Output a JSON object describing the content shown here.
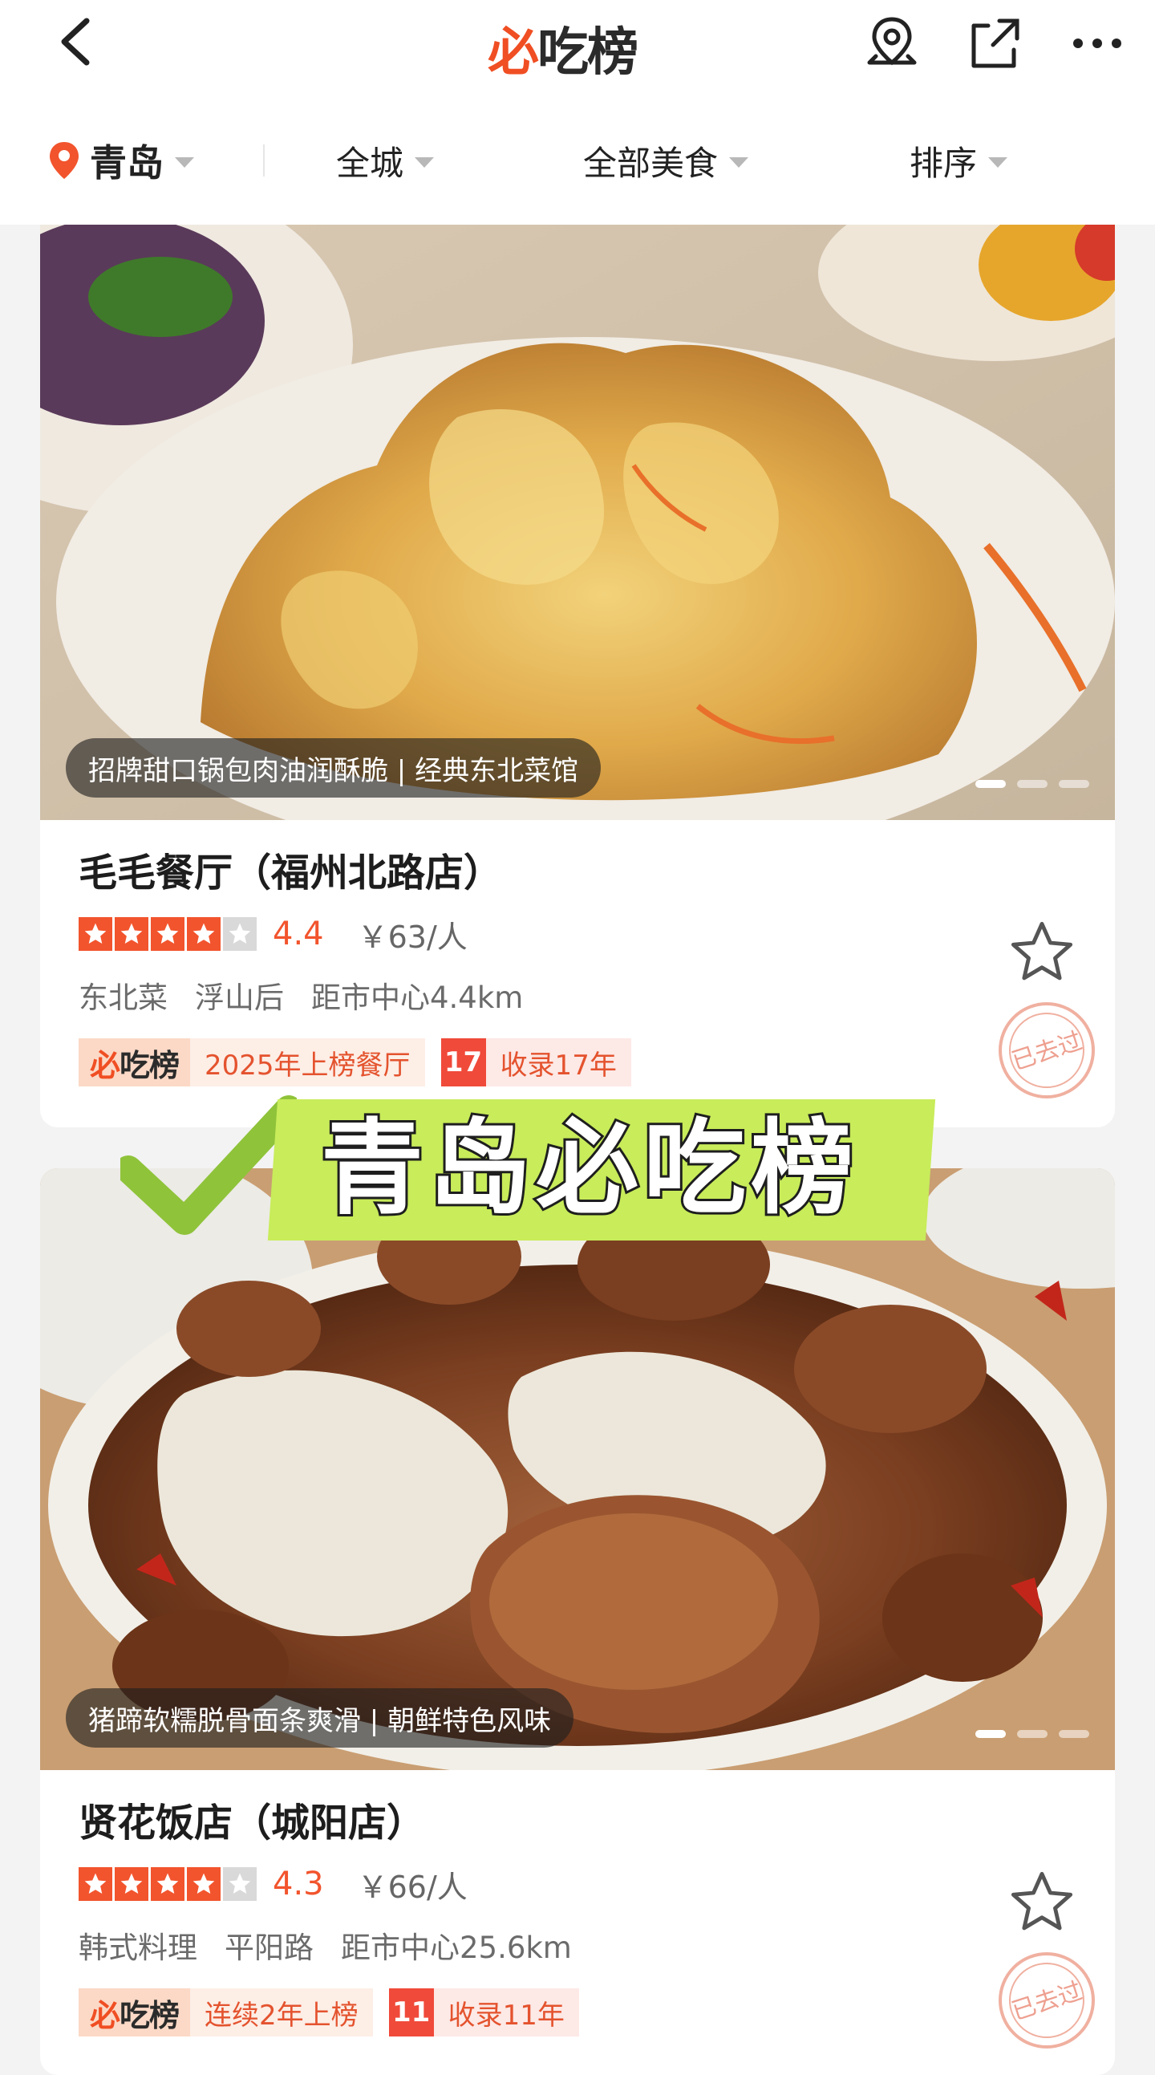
{
  "header": {
    "logo_mark": "必",
    "logo_text": "吃榜",
    "icons": [
      "back-icon",
      "location-icon",
      "share-icon",
      "more-icon"
    ]
  },
  "filters": {
    "city": "青岛",
    "area": "全城",
    "cuisine": "全部美食",
    "sort": "排序"
  },
  "overlay": {
    "title": "青岛必吃榜"
  },
  "restaurants": [
    {
      "caption": "招牌甜口锅包肉油润酥脆 | 经典东北菜馆",
      "name": "毛毛餐厅（福州北路店）",
      "stars": 4,
      "score": "4.4",
      "price": "￥63/人",
      "cuisine": "东北菜",
      "location": "浮山后",
      "distance": "距市中心4.4km",
      "badge_logo_mark": "必",
      "badge_logo_text": "吃榜",
      "badge": "2025年上榜餐厅",
      "years_num": "17",
      "years_text": "收录17年",
      "stamp": "已去过"
    },
    {
      "caption": "猪蹄软糯脱骨面条爽滑 | 朝鲜特色风味",
      "name": "贤花饭店（城阳店）",
      "stars": 4,
      "score": "4.3",
      "price": "￥66/人",
      "cuisine": "韩式料理",
      "location": "平阳路",
      "distance": "距市中心25.6km",
      "badge_logo_mark": "必",
      "badge_logo_text": "吃榜",
      "badge": "连续2年上榜",
      "years_num": "11",
      "years_text": "收录11年",
      "stamp": "已去过"
    }
  ],
  "colors": {
    "accent": "#f2542d",
    "overlay_green": "#c8ec5a",
    "star_off": "#d9d9d9"
  }
}
